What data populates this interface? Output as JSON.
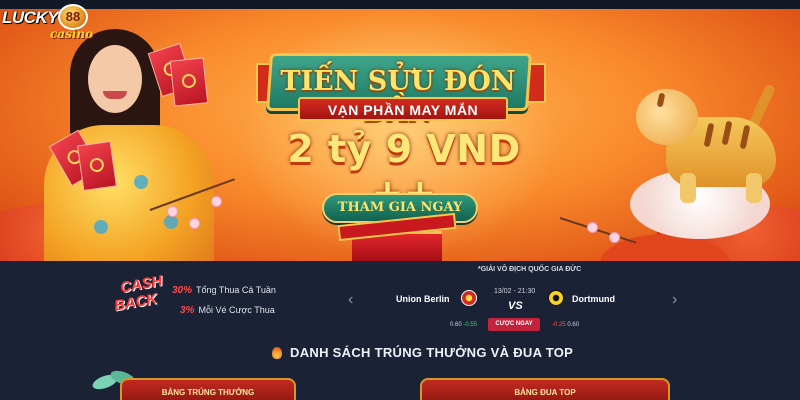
{
  "brand": {
    "name": "LUCKY",
    "number": "88",
    "sub": "casino"
  },
  "banner": {
    "title": "TIẾN SỬU ĐÓN DẦN",
    "subtitle": "VẠN PHẦN MAY MẮN",
    "amount": "2 tỷ 9 VND ++",
    "cta": "THAM GIA NGAY"
  },
  "cashback": {
    "badge_line1": "CASH",
    "badge_line2": "BACK",
    "rows": [
      {
        "pct": "30%",
        "text": "Tổng Thua Cả Tuần"
      },
      {
        "pct": "3%",
        "text": "Mỗi Vé Cược Thua"
      }
    ]
  },
  "match": {
    "league": "*GIẢI VÔ ĐỊCH QUỐC GIA ĐỨC",
    "time": "13/02 - 21:30",
    "home": "Union Berlin",
    "away": "Dortmund",
    "vs": "VS",
    "home_odds": [
      "0.60",
      "-0.55"
    ],
    "away_odds": [
      "-0.25",
      "0.60"
    ],
    "bet_label": "CƯỢC NGAY",
    "prev_arrow": "‹",
    "next_arrow": "›"
  },
  "winners": {
    "title": "DANH SÁCH TRÚNG THƯỞNG VÀ ĐUA TOP",
    "panels": [
      "BẢNG TRÚNG THƯỞNG",
      "BẢNG ĐUA TOP"
    ]
  },
  "colors": {
    "accent_gold": "#f5c64c",
    "banner_orange": "#f98a2c",
    "page_bg": "#1b2236",
    "cta_green": "#12624f",
    "bet_red": "#c2223b"
  }
}
